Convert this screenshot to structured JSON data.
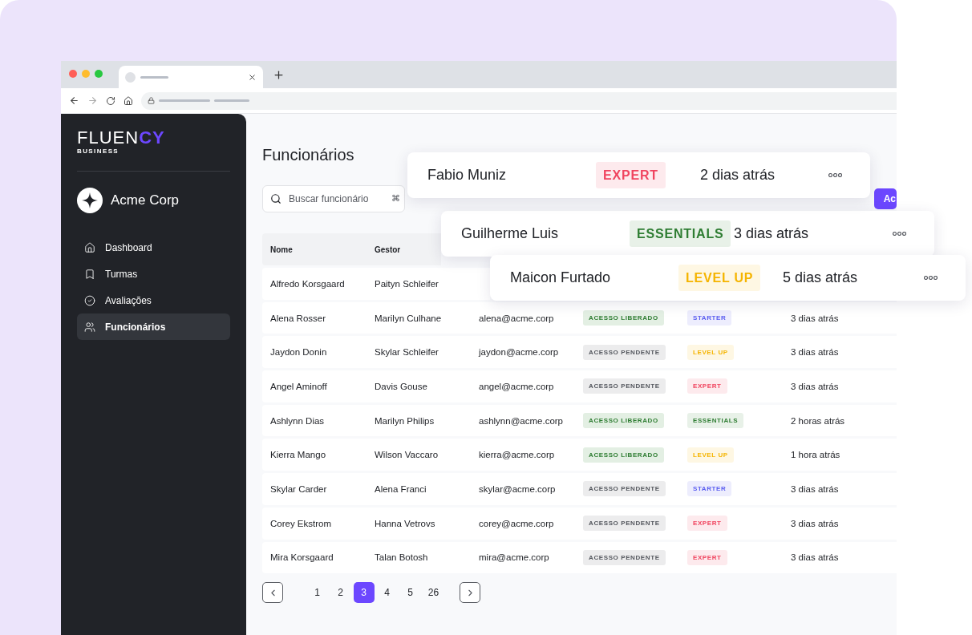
{
  "sidebar": {
    "logo": {
      "word": "FLUEN",
      "accent": "CY",
      "tagline": "BUSINESS"
    },
    "org": "Acme Corp",
    "items": [
      {
        "label": "Dashboard",
        "selected": false
      },
      {
        "label": "Turmas",
        "selected": false
      },
      {
        "label": "Avaliações",
        "selected": false
      },
      {
        "label": "Funcionários",
        "selected": true
      }
    ]
  },
  "page_title": "Funcionários",
  "search": {
    "placeholder": "Buscar funcionário",
    "shortcut": "⌘"
  },
  "add_button": "Ac",
  "table": {
    "columns": [
      "Nome",
      "Gestor"
    ],
    "rows": [
      {
        "name": "Alfredo Korsgaard",
        "manager": "Paityn Schleifer"
      },
      {
        "name": "Alena Rosser",
        "manager": "Marilyn Culhane",
        "email": "alena@acme.corp",
        "access": {
          "label": "ACESSO LIBERADO",
          "granted": true
        },
        "plan": {
          "label": "STARTER",
          "color": "#5b5ef0"
        },
        "time": "3 dias atrás"
      },
      {
        "name": "Jaydon Donin",
        "manager": "Skylar Schleifer",
        "email": "jaydon@acme.corp",
        "access": {
          "label": "ACESSO PENDENTE",
          "granted": false
        },
        "plan": {
          "label": "LEVEL UP",
          "color": "#f5b400"
        },
        "time": "3 dias atrás"
      },
      {
        "name": "Angel Aminoff",
        "manager": "Davis Gouse",
        "email": "angel@acme.corp",
        "access": {
          "label": "ACESSO PENDENTE",
          "granted": false
        },
        "plan": {
          "label": "EXPERT",
          "color": "#f0445f"
        },
        "time": "3 dias atrás"
      },
      {
        "name": "Ashlynn Dias",
        "manager": "Marilyn Philips",
        "email": "ashlynn@acme.corp",
        "access": {
          "label": "ACESSO LIBERADO",
          "granted": true
        },
        "plan": {
          "label": "ESSENTIALS",
          "color": "#2e7d32"
        },
        "time": "2 horas atrás"
      },
      {
        "name": "Kierra Mango",
        "manager": "Wilson Vaccaro",
        "email": "kierra@acme.corp",
        "access": {
          "label": "ACESSO LIBERADO",
          "granted": true
        },
        "plan": {
          "label": "LEVEL UP",
          "color": "#f5b400"
        },
        "time": "1 hora atrás"
      },
      {
        "name": "Skylar Carder",
        "manager": "Alena Franci",
        "email": "skylar@acme.corp",
        "access": {
          "label": "ACESSO PENDENTE",
          "granted": false
        },
        "plan": {
          "label": "STARTER",
          "color": "#5b5ef0"
        },
        "time": "3 dias atrás"
      },
      {
        "name": "Corey Ekstrom",
        "manager": "Hanna Vetrovs",
        "email": "corey@acme.corp",
        "access": {
          "label": "ACESSO PENDENTE",
          "granted": false
        },
        "plan": {
          "label": "EXPERT",
          "color": "#f0445f"
        },
        "time": "3 dias atrás"
      },
      {
        "name": "Mira Korsgaard",
        "manager": "Talan Botosh",
        "email": "mira@acme.corp",
        "access": {
          "label": "ACESSO PENDENTE",
          "granted": false
        },
        "plan": {
          "label": "EXPERT",
          "color": "#f0445f"
        },
        "time": "3 dias atrás"
      }
    ]
  },
  "pagination": [
    {
      "label": "1",
      "selected": false
    },
    {
      "label": "2",
      "selected": false
    },
    {
      "label": "3",
      "selected": true
    },
    {
      "label": "4",
      "selected": false
    },
    {
      "label": "5",
      "selected": false
    },
    {
      "label": "26",
      "selected": false
    }
  ],
  "cards": [
    {
      "name": "Fabio Muniz",
      "plan": {
        "label": "EXPERT",
        "color": "#f0445f"
      },
      "time": "2 dias atrás"
    },
    {
      "name": "Guilherme Luis",
      "plan": {
        "label": "ESSENTIALS",
        "color": "#2e7d32"
      },
      "time": "3 dias atrás"
    },
    {
      "name": "Maicon Furtado",
      "plan": {
        "label": "LEVEL UP",
        "color": "#f5b400"
      },
      "time": "5 dias atrás"
    }
  ]
}
